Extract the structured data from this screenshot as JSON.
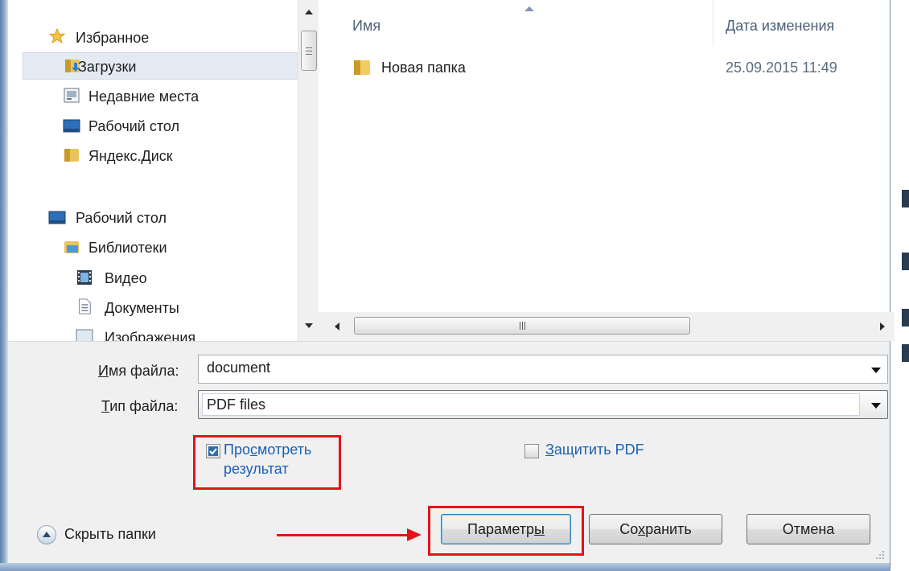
{
  "nav": {
    "favorites": "Избранное",
    "downloads": "Загрузки",
    "recent_places": "Недавние места",
    "desktop_fav": "Рабочий стол",
    "yandex_disk": "Яндекс.Диск",
    "desktop": "Рабочий стол",
    "libraries": "Библиотеки",
    "video": "Видео",
    "documents": "Документы",
    "images": "Изображения"
  },
  "file_list": {
    "columns": {
      "name": "Имя",
      "date_modified": "Дата изменения"
    },
    "items": [
      {
        "name": "Новая папка",
        "date": "25.09.2015 11:49",
        "icon": "folder-icon"
      }
    ],
    "scroll_grip": "III"
  },
  "form": {
    "filename_label_key": "И",
    "filename_label_rest": "мя файла:",
    "filename_value": "document",
    "filetype_label_key": "Т",
    "filetype_label_rest": "ип файла:",
    "filetype_value": "PDF files",
    "view_result_label_pre": "Про",
    "view_result_label_key": "с",
    "view_result_label_post": "мотреть",
    "view_result_label_line2": "результат",
    "view_result_checked": true,
    "protect_pdf_key": "З",
    "protect_pdf_rest": "ащитить PDF",
    "protect_pdf_checked": false
  },
  "buttons": {
    "hide_folders": "Скрыть папки",
    "parameters_pre": "Параметр",
    "parameters_key": "ы",
    "save_pre": "Со",
    "save_key": "х",
    "save_post": "ранить",
    "cancel": "Отмена"
  },
  "colors": {
    "highlight_red": "#e0151b",
    "link_blue": "#1a5fb4",
    "dialog_bg": "#f0f0f0",
    "selected_nav": "#e3eaf4"
  }
}
